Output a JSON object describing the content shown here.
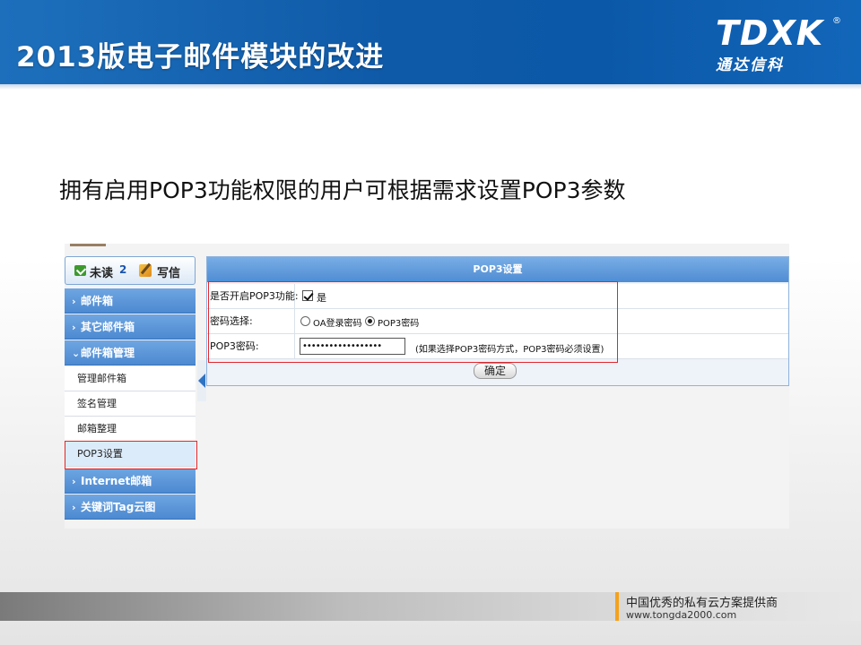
{
  "header": {
    "title": "2013版电子邮件模块的改进",
    "logo_mark": "TDXK",
    "logo_reg": "®",
    "logo_sub": "通达信科"
  },
  "slide_heading": "拥有启用POP3功能权限的用户可根据需求设置POP3参数",
  "sidebar": {
    "unread_label": "未读",
    "unread_count": "2",
    "write_label": "写信",
    "items": [
      {
        "label": "邮件箱",
        "chevron": "›"
      },
      {
        "label": "其它邮件箱",
        "chevron": "›"
      },
      {
        "label": "邮件箱管理",
        "chevron": "⌄"
      },
      {
        "label": "Internet邮箱",
        "chevron": "›"
      },
      {
        "label": "关键词Tag云图",
        "chevron": "›"
      }
    ],
    "subitems": [
      {
        "label": "管理邮件箱"
      },
      {
        "label": "签名管理"
      },
      {
        "label": "邮箱整理"
      },
      {
        "label": "POP3设置"
      }
    ]
  },
  "form": {
    "title": "POP3设置",
    "enable_label": "是否开启POP3功能:",
    "enable_option": "是",
    "password_type_label": "密码选择:",
    "option_oa": "OA登录密码",
    "option_pop3": "POP3密码",
    "pop3_password_label": "POP3密码:",
    "pop3_password_value": "••••••••••••••••••",
    "pop3_password_note": "(如果选择POP3密码方式，POP3密码必须设置)",
    "confirm_button": "确定"
  },
  "footer": {
    "slogan": "中国优秀的私有云方案提供商",
    "url": "www.tongda2000.com"
  },
  "colors": {
    "header_blue": "#0f5aa8",
    "sidebar_blue": "#4c89d1",
    "highlight_red": "#e0262b",
    "footer_accent": "#f4a21c"
  }
}
